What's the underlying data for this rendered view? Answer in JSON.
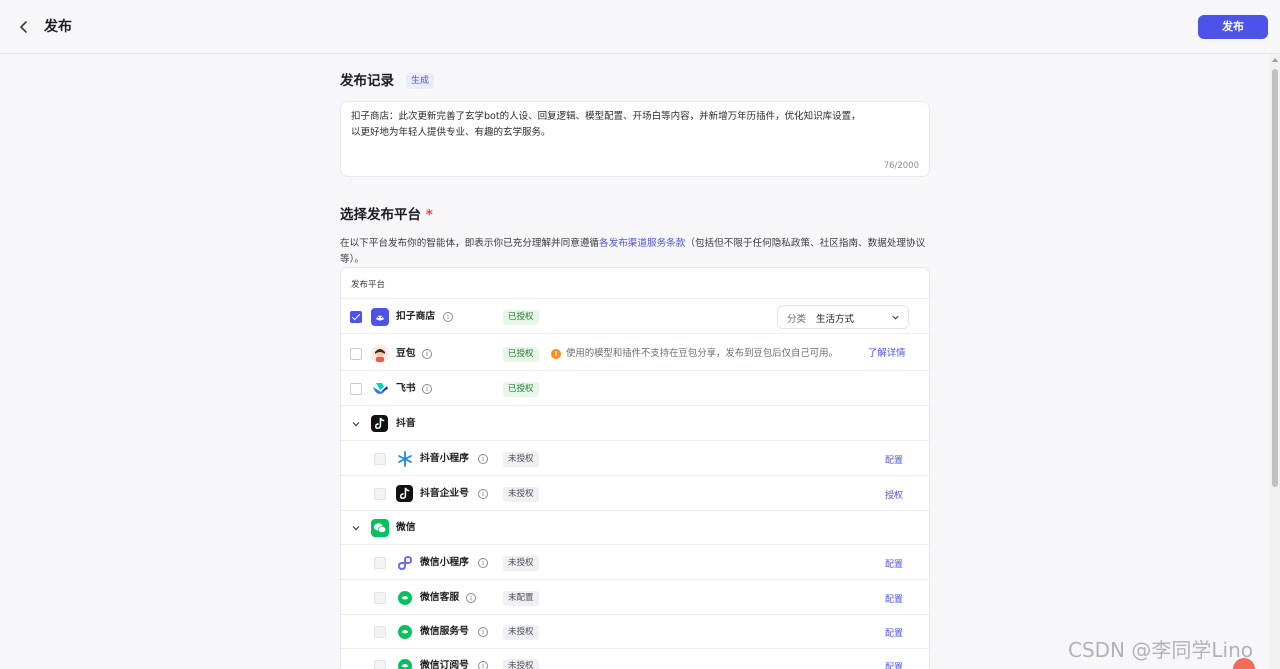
{
  "header": {
    "title": "发布",
    "publish_label": "发布"
  },
  "record": {
    "title": "发布记录",
    "generate_label": "生成",
    "text_line1": "扣子商店：此次更新完善了玄学bot的人设、回复逻辑、模型配置、开场白等内容，并新增万年历插件，优化知识库设置，",
    "text_line2": "以更好地为年轻人提供专业、有趣的玄学服务。",
    "char_count": "76/2000"
  },
  "platform": {
    "title": "选择发布平台",
    "required_mark": "*",
    "desc_before": "在以下平台发布你的智能体，即表示你已充分理解并同意遵循",
    "desc_link": "各发布渠道服务条款",
    "desc_after": "（包括但不限于任何隐私政策、社区指南、数据处理协议等）。",
    "table_header": "发布平台"
  },
  "rows": {
    "coze": {
      "name": "扣子商店",
      "badge": "已授权",
      "category_label": "分类",
      "category_value": "生活方式",
      "checked": true
    },
    "doubao": {
      "name": "豆包",
      "badge": "已授权",
      "warning": "使用的模型和插件不支持在豆包分享，发布到豆包后仅自己可用。",
      "learn_more": "了解详情"
    },
    "feishu": {
      "name": "飞书",
      "badge": "已授权"
    },
    "douyin": {
      "name": "抖音"
    },
    "douyin_mini": {
      "name": "抖音小程序",
      "badge": "未授权",
      "action": "配置"
    },
    "douyin_ent": {
      "name": "抖音企业号",
      "badge": "未授权",
      "action": "授权"
    },
    "wechat": {
      "name": "微信"
    },
    "wechat_mini": {
      "name": "微信小程序",
      "badge": "未授权",
      "action": "配置"
    },
    "wechat_service": {
      "name": "微信客服",
      "badge": "未配置",
      "action": "配置"
    },
    "wechat_official": {
      "name": "微信服务号",
      "badge": "未授权",
      "action": "配置"
    },
    "wechat_sub": {
      "name": "微信订阅号",
      "badge": "未授权",
      "action": "配置"
    }
  },
  "watermark": "CSDN @李同学Lino",
  "colors": {
    "accent": "#4d53e8",
    "authorized": "#2c7a3a",
    "warning": "#ff8a1f"
  }
}
